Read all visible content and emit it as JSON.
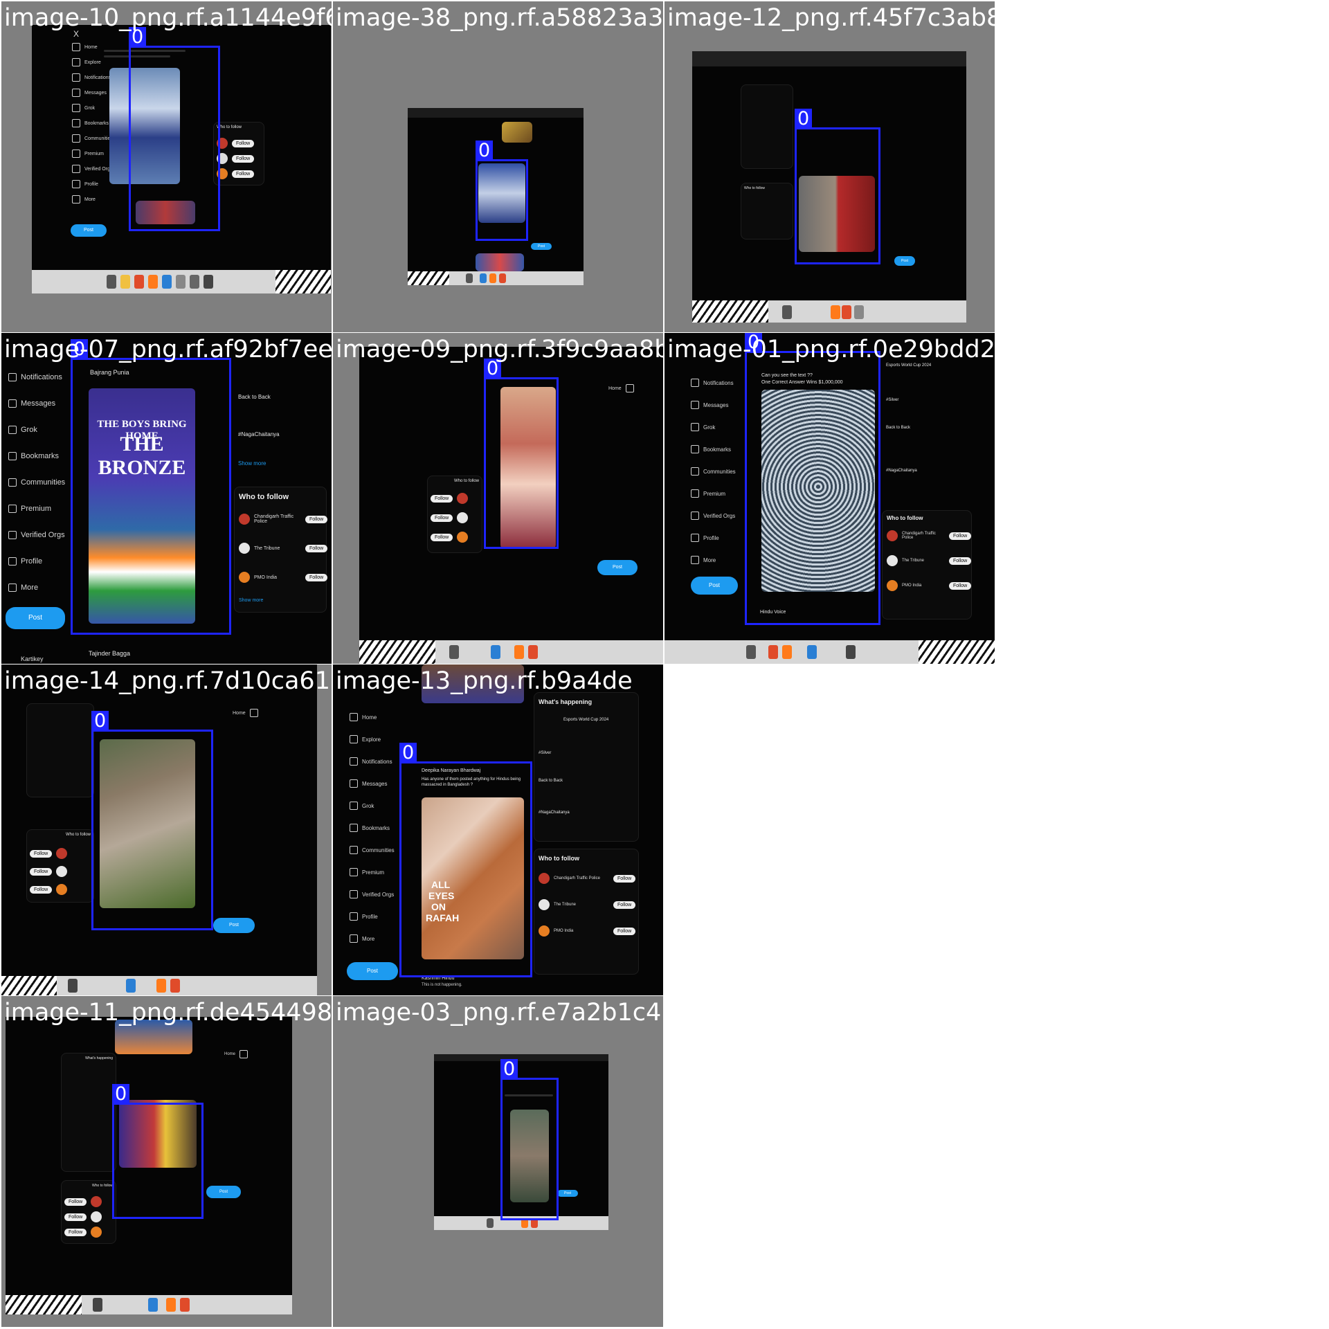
{
  "tiles": [
    {
      "filename": "image-10_png.rf.a1144e9f6dcad3391eb5f63025b6c2562f2da52408a45261e6cc74e92de6f748475c8",
      "label": "0"
    },
    {
      "filename": "image-38_png.rf.a58823a36d5ed5bc1e6ebc4f4bc96",
      "label": "0"
    },
    {
      "filename": "image-12_png.rf.45f7c3ab8ea0b5a5f1fe01ab4e",
      "label": "0"
    },
    {
      "filename": "image-07_png.rf.af92bf7eecc2048e4b876c02617027fb8fc3bab74c9dad2ba04a37602afaa4201c4f37c051",
      "label": "0"
    },
    {
      "filename": "image-09_png.rf.3f9c9aa8b1",
      "label": "0"
    },
    {
      "filename": "image-01_png.rf.0e29bdd2",
      "label": "0"
    },
    {
      "filename": "image-14_png.rf.7d10ca6161f13326a0b9740804851bac28e16755dd349bb7",
      "label": "0"
    },
    {
      "filename": "image-13_png.rf.b9a4de",
      "label": "0"
    },
    {
      "filename": "image-11_png.rf.de454498c1c14593d2dd2f69ffb690ffe87416540552cf2",
      "label": "0"
    },
    {
      "filename": "image-03_png.rf.e7a2b1c4",
      "label": "0"
    }
  ],
  "x_ui": {
    "nav": [
      "Home",
      "Explore",
      "Notifications",
      "Messages",
      "Grok",
      "Bookmarks",
      "Communities",
      "Premium",
      "Verified Orgs",
      "Profile",
      "More"
    ],
    "post_button": "Post",
    "who_to_follow": "Who to follow",
    "whats_happening": "What's happening",
    "follow_label": "Follow",
    "follow_accounts": [
      "Chandigarh Traffic Police",
      "The Tribune",
      "PMO India"
    ],
    "trends": [
      "Back to Back",
      "#NagaChaitanya",
      "#Silver"
    ],
    "esports": "Esports World Cup 2024",
    "show_more": "Show more"
  },
  "posts": {
    "tile4_author": "Bajrang Punia",
    "tile4_headline_top": "THE BOYS BRING HOME",
    "tile4_headline_big": "THE BRONZE",
    "tile6_author": "Hindu Voice",
    "tile6_caption_1": "Can you see the text ??",
    "tile6_caption_2": "One Correct Answer Wins $1,000,000",
    "tile8_author": "Deepika Narayan Bhardwaj",
    "tile8_caption": "Has anyone of them posted anything for Hindus being massacred in Bangladesh ?",
    "tile8_banner_1": "ALL",
    "tile8_banner_2": "EYES",
    "tile8_banner_3": "ON",
    "tile8_banner_4": "RAFAH",
    "tile8_reply_author": "Kashmiri Hindu",
    "tile8_reply_text": "This is not happening.",
    "tile4_reply_author": "Tajinder Bagga",
    "tile4_user": "Kartikey"
  },
  "colors": {
    "bbox": "#1e24ff",
    "tile_bg": "#7f7f7f",
    "x_bg": "#050505",
    "accent": "#1d9bf0"
  }
}
